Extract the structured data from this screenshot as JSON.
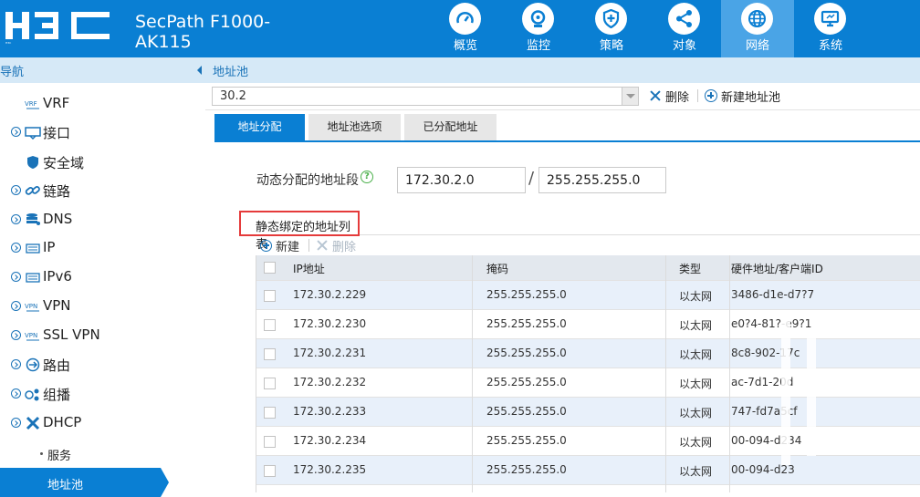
{
  "header": {
    "product_line1": "SecPath F1000-",
    "product_line2": "AK115",
    "nav": [
      {
        "label": "概览",
        "icon": "gauge-icon",
        "active": false
      },
      {
        "label": "监控",
        "icon": "camera-icon",
        "active": false
      },
      {
        "label": "策略",
        "icon": "shield-plus-icon",
        "active": false
      },
      {
        "label": "对象",
        "icon": "share-icon",
        "active": false
      },
      {
        "label": "网络",
        "icon": "globe-icon",
        "active": true
      },
      {
        "label": "系统",
        "icon": "monitor-icon",
        "active": false
      }
    ],
    "colors": {
      "bar": "#0a7fd3",
      "active_tab": "#4aa4e6"
    }
  },
  "sidebar": {
    "title": "导航",
    "items": [
      {
        "label": "VRF",
        "icon": "vrf-icon"
      },
      {
        "label": "接口",
        "icon": "interface-icon",
        "expandable": true
      },
      {
        "label": "安全域",
        "icon": "shield-icon"
      },
      {
        "label": "链路",
        "icon": "link-icon",
        "expandable": true
      },
      {
        "label": "DNS",
        "icon": "database-icon",
        "expandable": true
      },
      {
        "label": "IP",
        "icon": "ip-icon",
        "expandable": true
      },
      {
        "label": "IPv6",
        "icon": "ipv6-icon",
        "expandable": true
      },
      {
        "label": "VPN",
        "icon": "vpn-icon",
        "expandable": true
      },
      {
        "label": "SSL VPN",
        "icon": "sslvpn-icon",
        "expandable": true
      },
      {
        "label": "路由",
        "icon": "route-icon",
        "expandable": true
      },
      {
        "label": "组播",
        "icon": "multicast-icon",
        "expandable": true
      },
      {
        "label": "DHCP",
        "icon": "dhcp-icon",
        "expandable": true
      },
      {
        "label": "服务",
        "sub": true
      },
      {
        "label": "地址池",
        "sub": true,
        "active": true
      }
    ]
  },
  "main": {
    "title": "地址池",
    "pool_select": {
      "value": "30.2"
    },
    "toolbar": {
      "delete_label": "删除",
      "new_pool_label": "新建地址池"
    },
    "tabs": [
      {
        "label": "地址分配",
        "active": true
      },
      {
        "label": "地址池选项",
        "active": false
      },
      {
        "label": "已分配地址",
        "active": false
      }
    ],
    "dynamic_range": {
      "label": "动态分配的地址段",
      "ip": "172.30.2.0",
      "mask": "255.255.255.0"
    },
    "static_binding": {
      "title": "静态绑定的地址列表",
      "new_label": "新建",
      "delete_label": "删除",
      "columns": [
        "IP地址",
        "掩码",
        "类型",
        "硬件地址/客户端ID"
      ],
      "rows": [
        {
          "ip": "172.30.2.229",
          "mask": "255.255.255.0",
          "type": "以太网",
          "hw": "3486-d1e-d7?7"
        },
        {
          "ip": "172.30.2.230",
          "mask": "255.255.255.0",
          "type": "以太网",
          "hw": "e0?4-81?-e9?1"
        },
        {
          "ip": "172.30.2.231",
          "mask": "255.255.255.0",
          "type": "以太网",
          "hw": "8c8-902-17c"
        },
        {
          "ip": "172.30.2.232",
          "mask": "255.255.255.0",
          "type": "以太网",
          "hw": "ac-7d1-20d"
        },
        {
          "ip": "172.30.2.233",
          "mask": "255.255.255.0",
          "type": "以太网",
          "hw": "747-fd7a5cf"
        },
        {
          "ip": "172.30.2.234",
          "mask": "255.255.255.0",
          "type": "以太网",
          "hw": "00-094-d234"
        },
        {
          "ip": "172.30.2.235",
          "mask": "255.255.255.0",
          "type": "以太网",
          "hw": "00-094-d23"
        }
      ]
    }
  }
}
